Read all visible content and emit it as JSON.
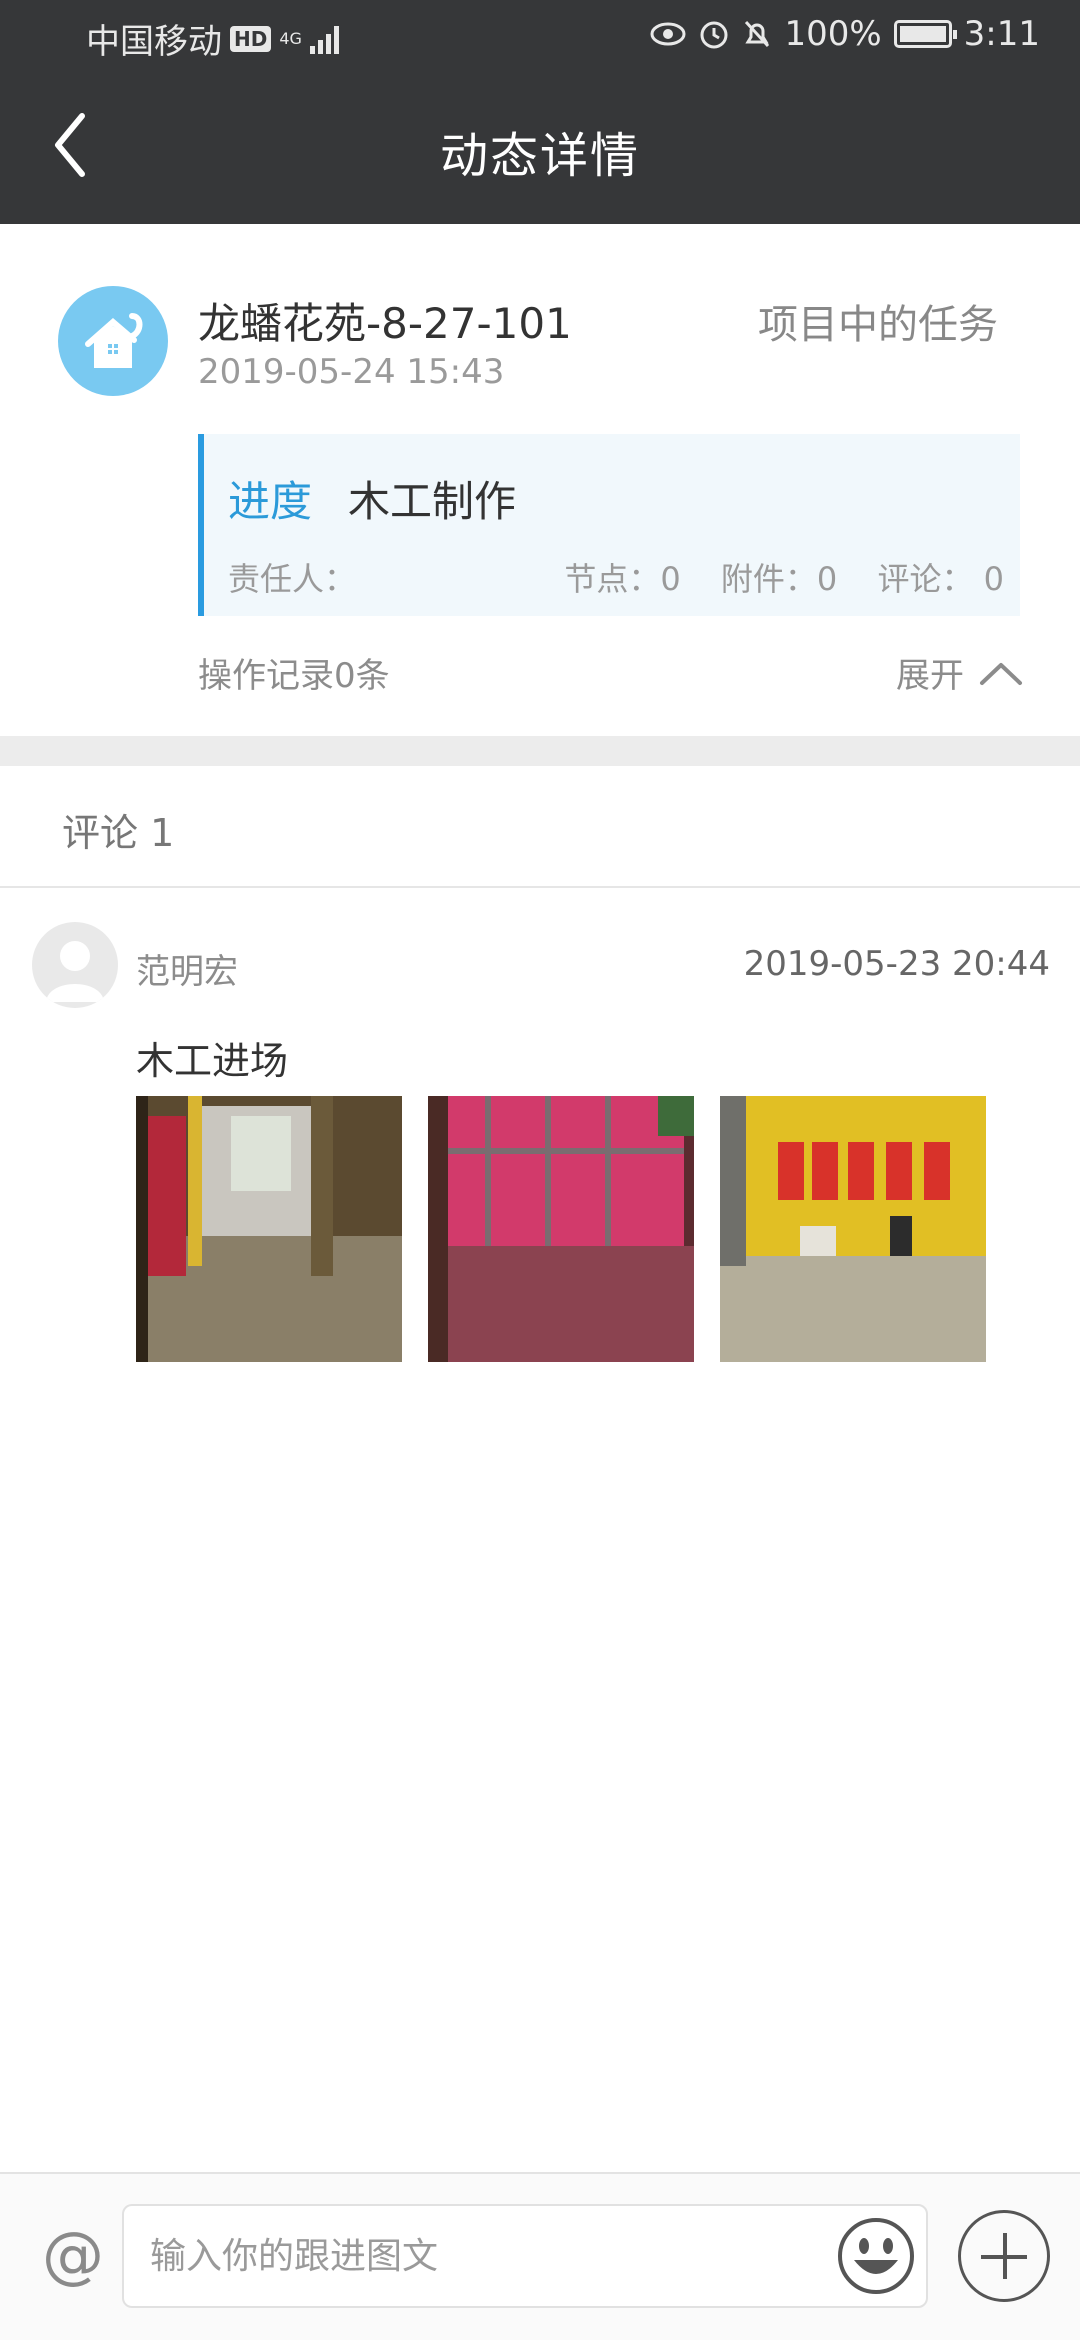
{
  "status_bar": {
    "carrier": "中国移动",
    "hd": "HD",
    "network": "4G",
    "battery": "100%",
    "time": "3:11"
  },
  "nav": {
    "title": "动态详情"
  },
  "post": {
    "project_name": "龙蟠花苑-8-27-101",
    "time": "2019-05-24 15:43",
    "type": "项目中的任务",
    "task": {
      "label": "进度",
      "name": "木工制作",
      "owner_label": "责任人：",
      "nodes": "节点：0",
      "attachments": "附件：0",
      "comments": "评论：  0"
    },
    "op_log": "操作记录0条",
    "expand": "展开"
  },
  "comments": {
    "header": "评论 1",
    "items": [
      {
        "user": "范明宏",
        "time": "2019-05-23 20:44",
        "text": "木工进场"
      }
    ]
  },
  "composer": {
    "at_symbol": "@",
    "placeholder": "输入你的跟进图文"
  }
}
